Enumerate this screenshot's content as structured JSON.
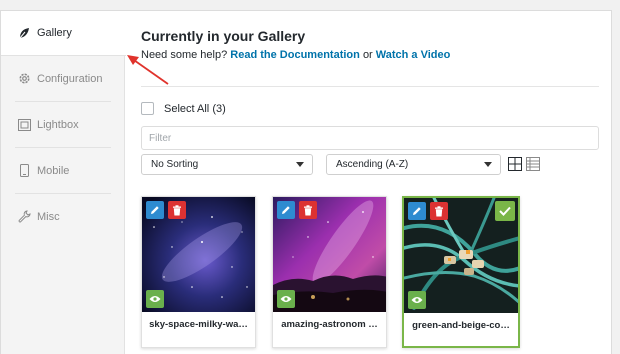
{
  "sidebar": {
    "items": [
      {
        "label": "Gallery",
        "icon": "leaf-icon",
        "active": true
      },
      {
        "label": "Configuration",
        "icon": "gear-icon"
      },
      {
        "label": "Lightbox",
        "icon": "lightbox-icon"
      },
      {
        "label": "Mobile",
        "icon": "mobile-icon"
      },
      {
        "label": "Misc",
        "icon": "wrench-icon"
      }
    ]
  },
  "header": {
    "title": "Currently in your Gallery",
    "help_prefix": "Need some help?",
    "doc_link": "Read the Documentation",
    "or": "or",
    "video_link": "Watch a Video"
  },
  "select_all": {
    "label": "Select All",
    "count": "(3)"
  },
  "filter": {
    "placeholder": "Filter"
  },
  "sorting": {
    "selected": "No Sorting"
  },
  "order": {
    "selected": "Ascending (A-Z)"
  },
  "images": [
    {
      "caption": "sky-space-milky-wa…",
      "selected": false
    },
    {
      "caption": "amazing-astronom …",
      "selected": false
    },
    {
      "caption": "green-and-beige-co…",
      "selected": true
    }
  ],
  "colors": {
    "link": "#0073aa",
    "edit": "#2e8bd0",
    "delete": "#dc3232",
    "view": "#6ab04c",
    "selected_border": "#7ab648",
    "annotation_arrow": "#e0332c"
  }
}
